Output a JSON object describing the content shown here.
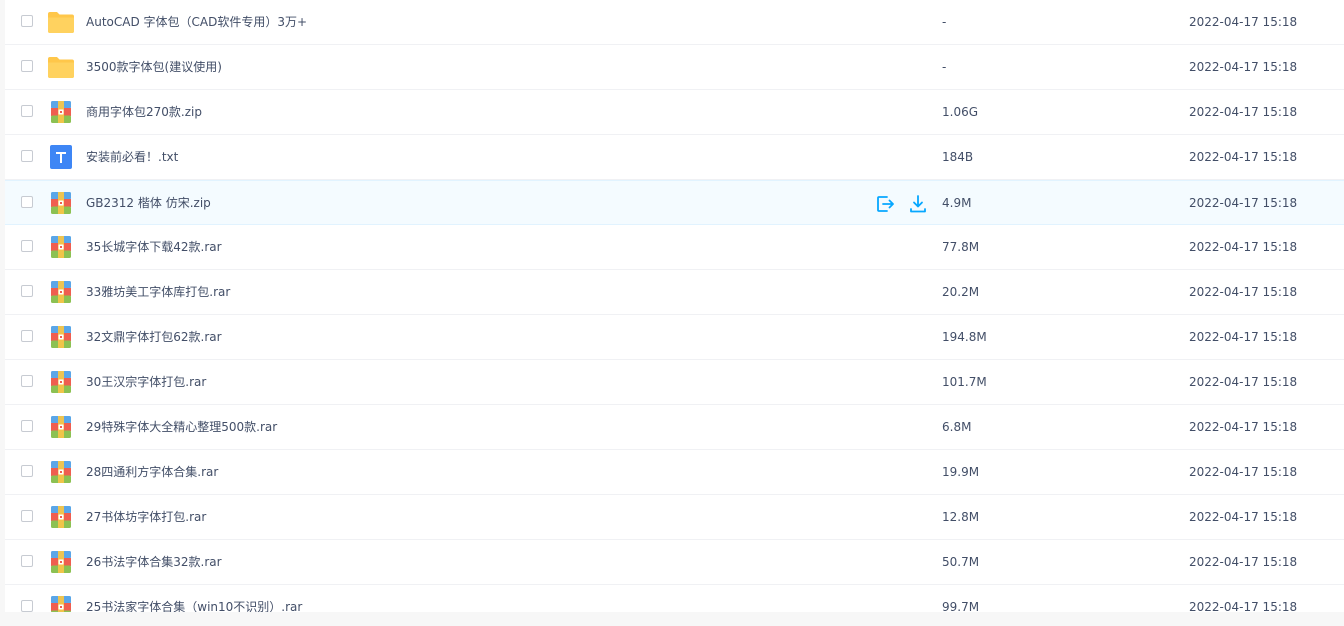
{
  "colors": {
    "folder": "#ffc74a",
    "text_icon": "#3e86f5",
    "archive_top": "#5aa6e8",
    "archive_mid": "#ef5e4f",
    "archive_bottom": "#8cc152",
    "action_blue": "#06a7ff",
    "hover_bg": "#f4fbff"
  },
  "actions": {
    "share_icon": "share-out-icon",
    "download_icon": "download-icon"
  },
  "files": [
    {
      "icon": "folder-icon",
      "name": "AutoCAD 字体包（CAD软件专用）3万+",
      "size": "-",
      "time": "2022-04-17 15:18"
    },
    {
      "icon": "folder-icon",
      "name": "3500款字体包(建议使用)",
      "size": "-",
      "time": "2022-04-17 15:18"
    },
    {
      "icon": "zip-archive-icon",
      "name": "商用字体包270款.zip",
      "size": "1.06G",
      "time": "2022-04-17 15:18"
    },
    {
      "icon": "txt-file-icon",
      "name": "安装前必看！.txt",
      "size": "184B",
      "time": "2022-04-17 15:18"
    },
    {
      "icon": "zip-archive-icon",
      "name": "GB2312 楷体 仿宋.zip",
      "size": "4.9M",
      "time": "2022-04-17 15:18",
      "hovered": true
    },
    {
      "icon": "rar-archive-icon",
      "name": "35长城字体下载42款.rar",
      "size": "77.8M",
      "time": "2022-04-17 15:18"
    },
    {
      "icon": "rar-archive-icon",
      "name": "33雅坊美工字体库打包.rar",
      "size": "20.2M",
      "time": "2022-04-17 15:18"
    },
    {
      "icon": "rar-archive-icon",
      "name": "32文鼎字体打包62款.rar",
      "size": "194.8M",
      "time": "2022-04-17 15:18"
    },
    {
      "icon": "rar-archive-icon",
      "name": "30王汉宗字体打包.rar",
      "size": "101.7M",
      "time": "2022-04-17 15:18"
    },
    {
      "icon": "rar-archive-icon",
      "name": "29特殊字体大全精心整理500款.rar",
      "size": "6.8M",
      "time": "2022-04-17 15:18"
    },
    {
      "icon": "rar-archive-icon",
      "name": "28四通利方字体合集.rar",
      "size": "19.9M",
      "time": "2022-04-17 15:18"
    },
    {
      "icon": "rar-archive-icon",
      "name": "27书体坊字体打包.rar",
      "size": "12.8M",
      "time": "2022-04-17 15:18"
    },
    {
      "icon": "rar-archive-icon",
      "name": "26书法字体合集32款.rar",
      "size": "50.7M",
      "time": "2022-04-17 15:18"
    },
    {
      "icon": "rar-archive-icon",
      "name": "25书法家字体合集（win10不识别）.rar",
      "size": "99.7M",
      "time": "2022-04-17 15:18"
    }
  ]
}
